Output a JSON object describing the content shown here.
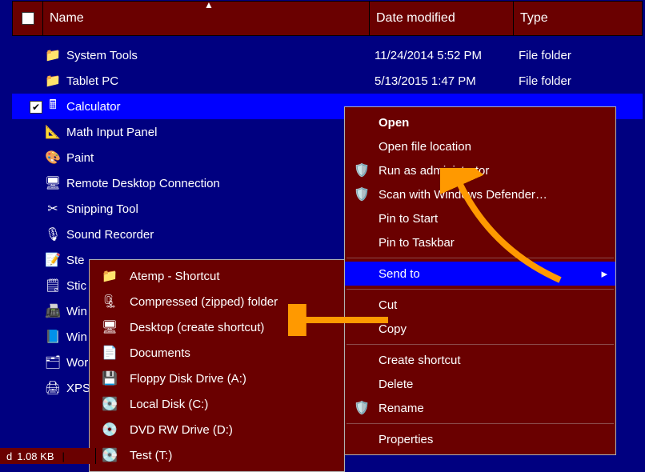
{
  "columns": {
    "name": "Name",
    "date": "Date modified",
    "type": "Type"
  },
  "rows": [
    {
      "icon": "📁",
      "name": "System Tools",
      "date": "11/24/2014 5:52 PM",
      "type": "File folder",
      "checked": false,
      "selected": false
    },
    {
      "icon": "📁",
      "name": "Tablet PC",
      "date": "5/13/2015 1:47 PM",
      "type": "File folder",
      "checked": false,
      "selected": false
    },
    {
      "icon": "🖩",
      "name": "Calculator",
      "date": "",
      "type": "",
      "checked": true,
      "selected": true
    },
    {
      "icon": "📐",
      "name": "Math Input Panel",
      "date": "",
      "type": "",
      "checked": false,
      "selected": false
    },
    {
      "icon": "🎨",
      "name": "Paint",
      "date": "",
      "type": "",
      "checked": false,
      "selected": false
    },
    {
      "icon": "🖥",
      "name": "Remote Desktop Connection",
      "date": "",
      "type": "",
      "checked": false,
      "selected": false
    },
    {
      "icon": "✂",
      "name": "Snipping Tool",
      "date": "",
      "type": "",
      "checked": false,
      "selected": false
    },
    {
      "icon": "🎙",
      "name": "Sound Recorder",
      "date": "",
      "type": "",
      "checked": false,
      "selected": false
    },
    {
      "icon": "📝",
      "name": "Steps Recorder",
      "date": "",
      "type": "",
      "checked": false,
      "selected": false
    },
    {
      "icon": "🗒",
      "name": "Sticky Notes",
      "date": "",
      "type": "",
      "checked": false,
      "selected": false
    },
    {
      "icon": "📠",
      "name": "Windows Fax and Scan",
      "date": "",
      "type": "",
      "checked": false,
      "selected": false
    },
    {
      "icon": "📘",
      "name": "Windows Journal",
      "date": "",
      "type": "",
      "checked": false,
      "selected": false
    },
    {
      "icon": "🗂",
      "name": "WordPad",
      "date": "",
      "type": "",
      "checked": false,
      "selected": false
    },
    {
      "icon": "🖨",
      "name": "XPS Viewer",
      "date": "",
      "type": "",
      "checked": false,
      "selected": false
    }
  ],
  "ctx1": {
    "open": "Open",
    "open_location": "Open file location",
    "runas": "Run as administrator",
    "defender": "Scan with Windows Defender…",
    "pin_start": "Pin to Start",
    "pin_taskbar": "Pin to Taskbar",
    "sendto": "Send to",
    "cut": "Cut",
    "copy": "Copy",
    "create_shortcut": "Create shortcut",
    "delete": "Delete",
    "rename": "Rename",
    "properties": "Properties"
  },
  "ctx2": {
    "atemp": "Atemp - Shortcut",
    "zip": "Compressed (zipped) folder",
    "desktop": "Desktop (create shortcut)",
    "documents": "Documents",
    "floppy": "Floppy Disk Drive (A:)",
    "localc": "Local Disk (C:)",
    "dvd": "DVD RW Drive (D:)",
    "test": "Test (T:)"
  },
  "status": {
    "size": "1.08 KB"
  },
  "truncated_rows": {
    "r9": "Ste",
    "r10": "Stic",
    "r11": "Win",
    "r12": "Win",
    "r13": "Wor",
    "r14": "XPS"
  }
}
